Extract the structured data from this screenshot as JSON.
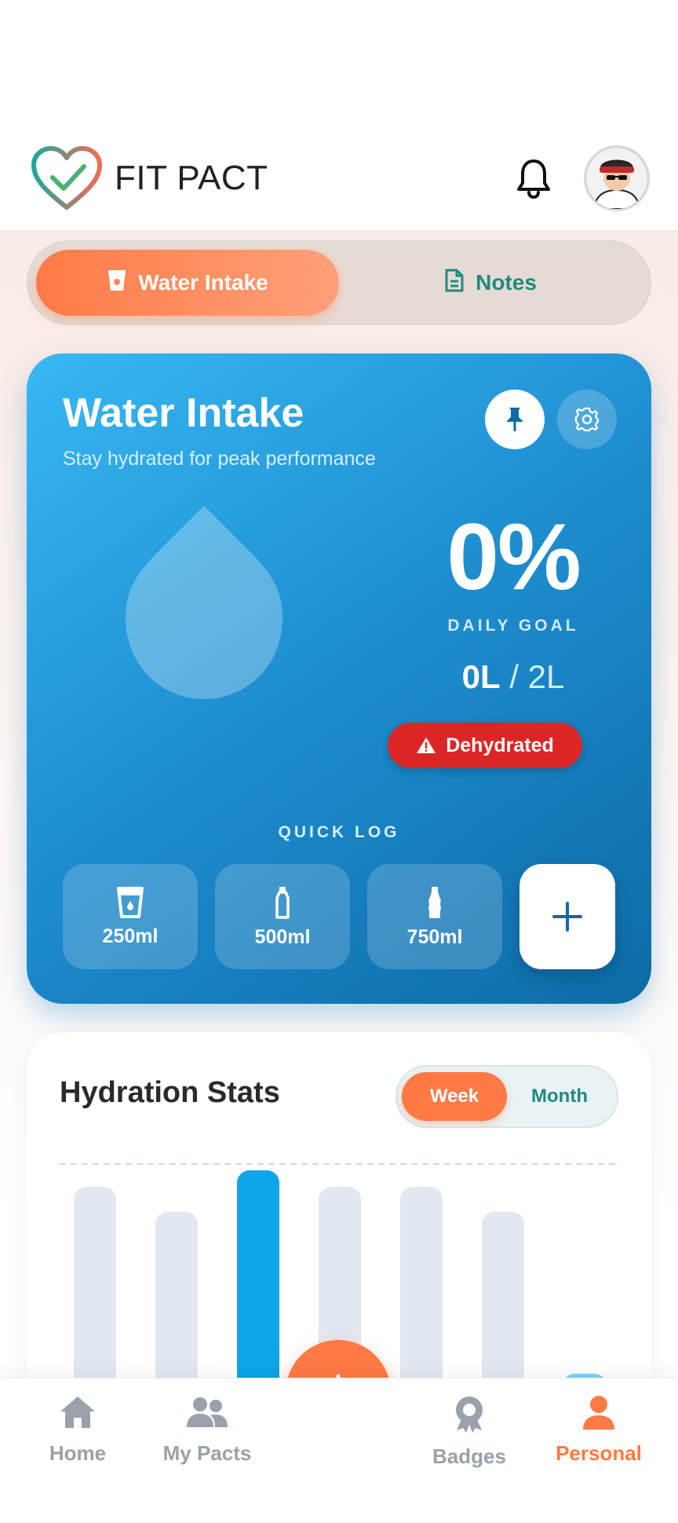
{
  "header": {
    "app_title": "FIT PACT",
    "icons": {
      "logo": "heart-check-logo",
      "notifications": "bell-icon",
      "avatar": "user-avatar"
    }
  },
  "tabs": [
    {
      "label": "Water Intake",
      "icon": "cup-icon",
      "active": true
    },
    {
      "label": "Notes",
      "icon": "note-icon",
      "active": false
    }
  ],
  "water_card": {
    "title": "Water Intake",
    "subtitle": "Stay hydrated for peak performance",
    "percent": "0%",
    "goal_label": "DAILY GOAL",
    "current": "0L",
    "separator": "/",
    "total": "2L",
    "status": "Dehydrated",
    "quick_log_label": "QUICK LOG",
    "quick_log": [
      {
        "label": "250ml",
        "icon": "glass-icon"
      },
      {
        "label": "500ml",
        "icon": "bottle-icon"
      },
      {
        "label": "750ml",
        "icon": "large-bottle-icon"
      }
    ],
    "colors": {
      "gradient_start": "#38b8f2",
      "gradient_end": "#0d6aa6",
      "status": "#dc2626"
    }
  },
  "stats": {
    "title": "Hydration Stats",
    "range_options": [
      {
        "label": "Week",
        "active": true
      },
      {
        "label": "Month",
        "active": false
      }
    ]
  },
  "chart_data": {
    "type": "bar",
    "categories": [
      "",
      "",
      "",
      "",
      "",
      "",
      ""
    ],
    "values": [
      0.92,
      0.8,
      1.0,
      0.92,
      0.92,
      0.8,
      0.02
    ],
    "highlight_index": 2,
    "goal_line": 1.0,
    "colors": {
      "default": "#e2e8f0",
      "highlight": "#0ea5e9",
      "last": "#7dd3fc"
    }
  },
  "bottom_nav": {
    "items": [
      {
        "label": "Home",
        "icon": "home-icon",
        "active": false
      },
      {
        "label": "My Pacts",
        "icon": "users-icon",
        "active": false
      },
      {
        "label": "Badges",
        "icon": "badge-icon",
        "active": false
      },
      {
        "label": "Personal",
        "icon": "person-icon",
        "active": true
      }
    ],
    "fab_icon": "plus-icon",
    "accent": "#ff7a45"
  }
}
